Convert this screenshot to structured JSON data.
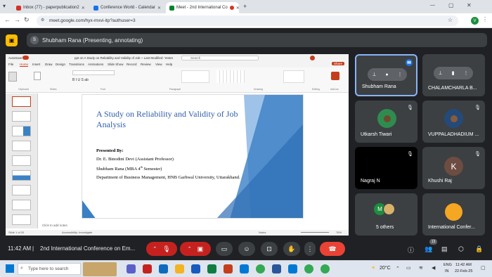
{
  "browser": {
    "tabs": [
      {
        "label": "Inbox (77) - paperpublication2",
        "color": "#d93025"
      },
      {
        "label": "Conference World - Calendar",
        "color": "#1a73e8"
      },
      {
        "label": "Meet - 2nd International Co",
        "color": "#00832d"
      }
    ],
    "url": "meet.google.com/hyx-mxvi-itp?authuser=3",
    "profile_initial": "V"
  },
  "meet": {
    "presenter_initial": "S",
    "presenter_label": "Shubham Rana (Presenting, annotating)",
    "participants": [
      {
        "name": "Shubham Rana",
        "kind": "active",
        "initial": ""
      },
      {
        "name": "CHALAMCHARLA B...",
        "kind": "dark",
        "initial": ""
      },
      {
        "name": "Utkarsh Tiwari",
        "kind": "photo",
        "initial": ""
      },
      {
        "name": "VUPPALADHADIUM ...",
        "kind": "photo",
        "initial": ""
      },
      {
        "name": "Nagraj N",
        "kind": "black",
        "initial": ""
      },
      {
        "name": "Khushi Raj",
        "kind": "letter",
        "initial": "K"
      },
      {
        "name": "5 others",
        "kind": "group",
        "initial": "M"
      },
      {
        "name": "International Confer...",
        "kind": "logo",
        "initial": ""
      }
    ],
    "time": "11:42 AM",
    "meeting_title": "2nd International Conference on Em...",
    "people_count": "13"
  },
  "ppt": {
    "autosave": "AutoSave",
    "doc_title": "ppt on A Study on Reliability and Validity of Job ~ Last Modified: Yesterday",
    "search_placeholder": "Search",
    "menu": [
      "File",
      "Home",
      "Insert",
      "Draw",
      "Design",
      "Transitions",
      "Animations",
      "Slide Show",
      "Record",
      "Review",
      "View",
      "Help"
    ],
    "share": "Share",
    "ribbon_groups": [
      "Clipboard",
      "Slides",
      "Font",
      "Paragraph",
      "Drawing",
      "Editing",
      "Add-ins"
    ],
    "slide": {
      "title": "A Study on Reliability and Validity of Job Analysis",
      "presented_by": "Presented By:",
      "line1": "Dr. E. Binodini Devi (Assistant Professor)",
      "line2_pre": "Shubham Rana (MBA 4",
      "line2_sup": "th",
      "line2_post": " Semester)",
      "line3": "Department of Business Management, HNB Garhwal University, Uttarakhand."
    },
    "notes_placeholder": "Click to add notes",
    "status_left": "Slide 1 of 20",
    "accessibility": "Accessibility: Investigate",
    "notes_btn": "Notes",
    "zoom": "76%"
  },
  "taskbar": {
    "search_placeholder": "Type here to search",
    "weather": "20°C",
    "lang": "ENG",
    "region": "IN",
    "time": "11:42 AM",
    "date": "22-Feb-25"
  }
}
